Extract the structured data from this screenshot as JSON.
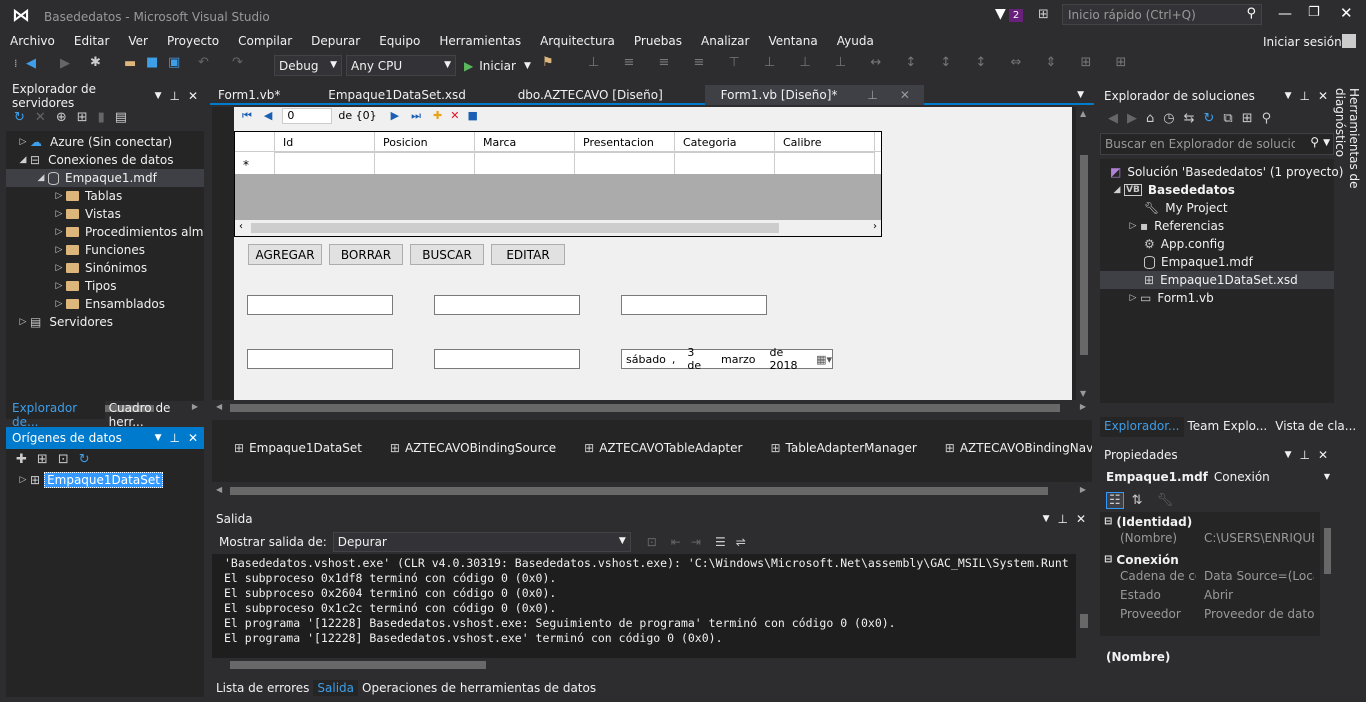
{
  "title": {
    "app": "Basededatos - Microsoft Visual Studio",
    "badge": "2",
    "quick_launch": "Inicio rápido (Ctrl+Q)",
    "signin": "Iniciar sesión"
  },
  "menu": [
    "Archivo",
    "Editar",
    "Ver",
    "Proyecto",
    "Compilar",
    "Depurar",
    "Equipo",
    "Herramientas",
    "Arquitectura",
    "Pruebas",
    "Analizar",
    "Ventana",
    "Ayuda"
  ],
  "toolbar": {
    "config": "Debug",
    "platform": "Any CPU",
    "start": "Iniciar"
  },
  "server_explorer": {
    "title": "Explorador de servidores",
    "items": [
      {
        "label": "Azure (Sin conectar)"
      },
      {
        "label": "Conexiones de datos"
      },
      {
        "label": "Empaque1.mdf"
      },
      {
        "label": "Tablas"
      },
      {
        "label": "Vistas"
      },
      {
        "label": "Procedimientos alm"
      },
      {
        "label": "Funciones"
      },
      {
        "label": "Sinónimos"
      },
      {
        "label": "Tipos"
      },
      {
        "label": "Ensamblados"
      },
      {
        "label": "Servidores"
      }
    ],
    "tabs": [
      "Explorador de...",
      "Cuadro de herr..."
    ]
  },
  "data_sources": {
    "title": "Orígenes de datos",
    "item": "Empaque1DataSet"
  },
  "doc_tabs": [
    "Form1.vb*",
    "Empaque1DataSet.xsd",
    "dbo.AZTECAVO [Diseño]",
    "Form1.vb [Diseño]*"
  ],
  "designer": {
    "nav": {
      "position": "0",
      "count": "de {0}"
    },
    "grid": {
      "columns": [
        "Id",
        "Posicion",
        "Marca",
        "Presentacion",
        "Categoria",
        "Calibre"
      ],
      "new_row": "*"
    },
    "buttons": {
      "add": "AGREGAR",
      "delete": "BORRAR",
      "search": "BUSCAR",
      "edit": "EDITAR"
    },
    "date": {
      "day_name": "sábado",
      "day": "3 de",
      "month": "marzo",
      "year": "de 2018"
    }
  },
  "tray": [
    "Empaque1DataSet",
    "AZTECAVOBindingSource",
    "AZTECAVOTableAdapter",
    "TableAdapterManager",
    "AZTECAVOBindingNaviga"
  ],
  "output": {
    "title": "Salida",
    "show_label": "Mostrar salida de:",
    "source": "Depurar",
    "lines": [
      "'Basededatos.vshost.exe' (CLR v4.0.30319: Basededatos.vshost.exe): 'C:\\Windows\\Microsoft.Net\\assembly\\GAC_MSIL\\System.Runt",
      "El subproceso 0x1df8 terminó con código 0 (0x0).",
      "El subproceso 0x2604 terminó con código 0 (0x0).",
      "El subproceso 0x1c2c terminó con código 0 (0x0).",
      "El programa '[12228] Basededatos.vshost.exe: Seguimiento de programa' terminó con código 0 (0x0).",
      "El programa '[12228] Basededatos.vshost.exe' terminó con código 0 (0x0)."
    ],
    "tabs": [
      "Lista de errores",
      "Salida",
      "Operaciones de herramientas de datos"
    ]
  },
  "solution_explorer": {
    "title": "Explorador de soluciones",
    "search": "Buscar en Explorador de soluciones (",
    "items": [
      {
        "label": "Solución 'Basededatos'  (1 proyecto)"
      },
      {
        "label": "Basededatos"
      },
      {
        "label": "My Project"
      },
      {
        "label": "Referencias"
      },
      {
        "label": "App.config"
      },
      {
        "label": "Empaque1.mdf"
      },
      {
        "label": "Empaque1DataSet.xsd"
      },
      {
        "label": "Form1.vb"
      }
    ],
    "tabs": [
      "Explorador...",
      "Team Explo...",
      "Vista de cla..."
    ]
  },
  "properties": {
    "title": "Propiedades",
    "object": "Empaque1.mdf",
    "object_type": "Conexión",
    "cat_identity": "(Identidad)",
    "cat_connection": "Conexión",
    "rows": [
      {
        "name": "(Nombre)",
        "value": "C:\\USERS\\ENRIQUE"
      },
      {
        "name": "Cadena de conexi",
        "value": "Data Source=(Loca"
      },
      {
        "name": "Estado",
        "value": "Abrir"
      },
      {
        "name": "Proveedor",
        "value": "Proveedor de datos"
      }
    ],
    "description": "(Nombre)"
  },
  "side_tab": "Herramientas de diagnóstico",
  "colors": {
    "accent": "#007acc",
    "selection": "#3399ff",
    "bg": "#2d2d30",
    "panel": "#252526"
  }
}
